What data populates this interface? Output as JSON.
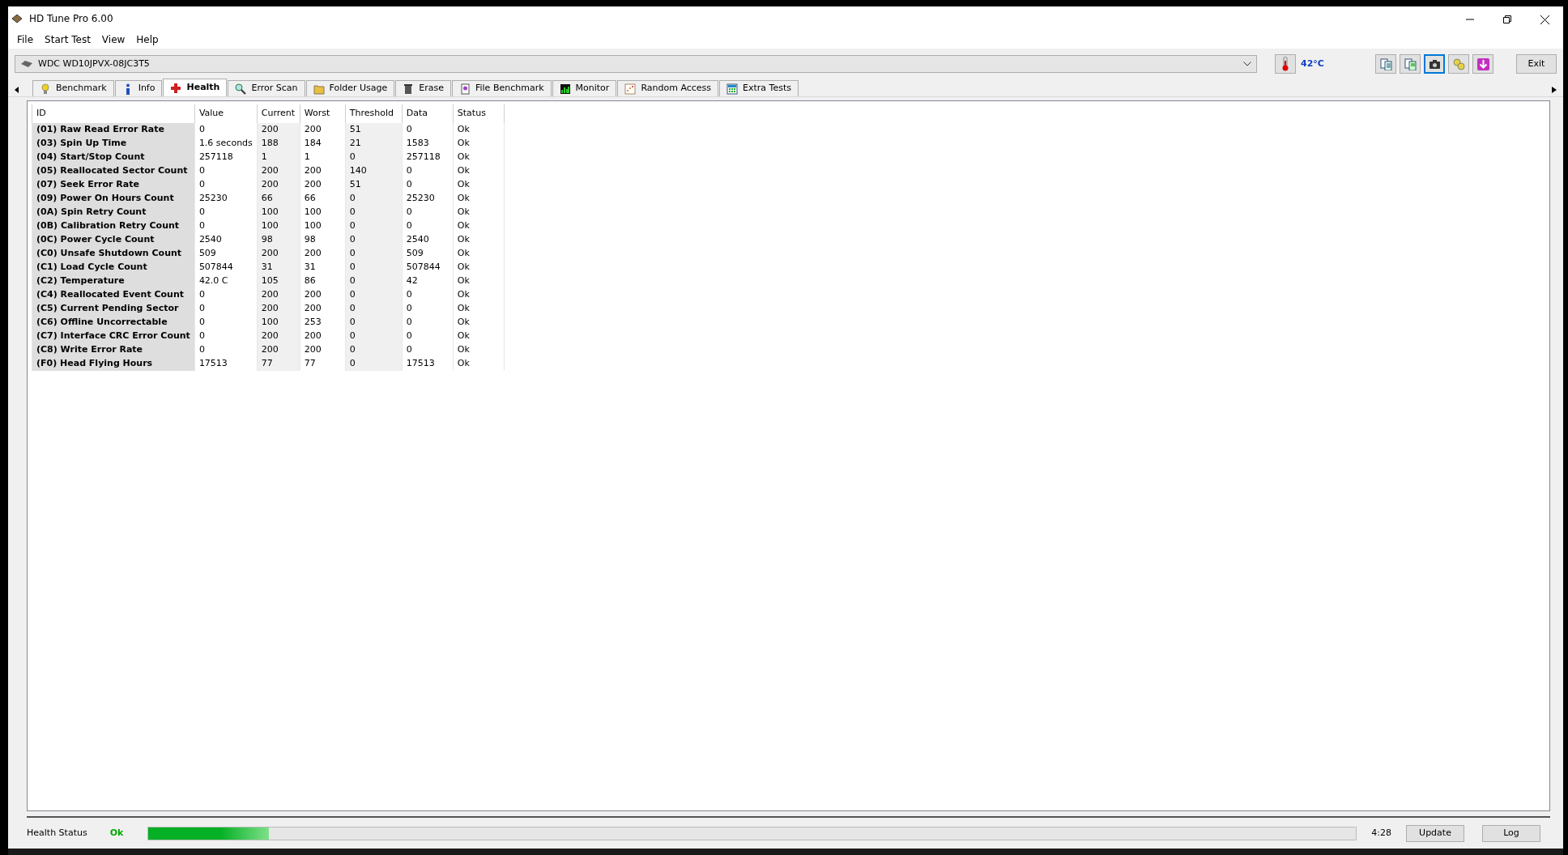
{
  "window": {
    "title": "HD Tune Pro 6.00"
  },
  "menu": [
    "File",
    "Start Test",
    "View",
    "Help"
  ],
  "drive": {
    "value": "WDC WD10JPVX-08JC3T5"
  },
  "temperature": "42°C",
  "toolbar_buttons": [
    {
      "selected": false
    },
    {
      "selected": false
    },
    {
      "selected": true
    },
    {
      "selected": false
    },
    {
      "selected": false
    }
  ],
  "exit_button": "Exit",
  "tabs": [
    {
      "label": "Benchmark",
      "selected": false
    },
    {
      "label": "Info",
      "selected": false
    },
    {
      "label": "Health",
      "selected": true
    },
    {
      "label": "Error Scan",
      "selected": false
    },
    {
      "label": "Folder Usage",
      "selected": false
    },
    {
      "label": "Erase",
      "selected": false
    },
    {
      "label": "File Benchmark",
      "selected": false
    },
    {
      "label": "Monitor",
      "selected": false
    },
    {
      "label": "Random Access",
      "selected": false
    },
    {
      "label": "Extra Tests",
      "selected": false
    }
  ],
  "table": {
    "columns": [
      "ID",
      "Value",
      "Current",
      "Worst",
      "Threshold",
      "Data",
      "Status"
    ],
    "rows": [
      [
        "(01) Raw Read Error Rate",
        "0",
        "200",
        "200",
        "51",
        "0",
        "Ok"
      ],
      [
        "(03) Spin Up Time",
        "1.6 seconds",
        "188",
        "184",
        "21",
        "1583",
        "Ok"
      ],
      [
        "(04) Start/Stop Count",
        "257118",
        "1",
        "1",
        "0",
        "257118",
        "Ok"
      ],
      [
        "(05) Reallocated Sector Count",
        "0",
        "200",
        "200",
        "140",
        "0",
        "Ok"
      ],
      [
        "(07) Seek Error Rate",
        "0",
        "200",
        "200",
        "51",
        "0",
        "Ok"
      ],
      [
        "(09) Power On Hours Count",
        "25230",
        "66",
        "66",
        "0",
        "25230",
        "Ok"
      ],
      [
        "(0A) Spin Retry Count",
        "0",
        "100",
        "100",
        "0",
        "0",
        "Ok"
      ],
      [
        "(0B) Calibration Retry Count",
        "0",
        "100",
        "100",
        "0",
        "0",
        "Ok"
      ],
      [
        "(0C) Power Cycle Count",
        "2540",
        "98",
        "98",
        "0",
        "2540",
        "Ok"
      ],
      [
        "(C0) Unsafe Shutdown Count",
        "509",
        "200",
        "200",
        "0",
        "509",
        "Ok"
      ],
      [
        "(C1) Load Cycle Count",
        "507844",
        "31",
        "31",
        "0",
        "507844",
        "Ok"
      ],
      [
        "(C2) Temperature",
        "42.0 C",
        "105",
        "86",
        "0",
        "42",
        "Ok"
      ],
      [
        "(C4) Reallocated Event Count",
        "0",
        "200",
        "200",
        "0",
        "0",
        "Ok"
      ],
      [
        "(C5) Current Pending Sector",
        "0",
        "200",
        "200",
        "0",
        "0",
        "Ok"
      ],
      [
        "(C6) Offline Uncorrectable",
        "0",
        "100",
        "253",
        "0",
        "0",
        "Ok"
      ],
      [
        "(C7) Interface CRC Error Count",
        "0",
        "200",
        "200",
        "0",
        "0",
        "Ok"
      ],
      [
        "(C8) Write Error Rate",
        "0",
        "200",
        "200",
        "0",
        "0",
        "Ok"
      ],
      [
        "(F0) Head Flying Hours",
        "17513",
        "77",
        "77",
        "0",
        "17513",
        "Ok"
      ]
    ]
  },
  "status_bar": {
    "label": "Health Status",
    "status": "Ok",
    "progress": {
      "level": 0.1
    },
    "time": "4:28",
    "buttons": [
      "Update",
      "Log"
    ]
  }
}
